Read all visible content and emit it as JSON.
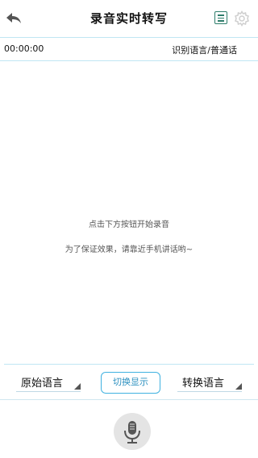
{
  "header": {
    "title": "录音实时转写",
    "back_icon": "back-arrow-icon",
    "list_icon": "list-icon",
    "settings_icon": "gear-icon"
  },
  "status": {
    "time": "00:00:00",
    "language_label": "识别语言/普通话"
  },
  "content": {
    "hint_line1": "点击下方按钮开始录音",
    "hint_line2": "为了保证效果，请靠近手机讲话哟~"
  },
  "controls": {
    "source_language": "原始语言",
    "switch_display": "切换显示",
    "target_language": "转换语言"
  },
  "record": {
    "icon": "microphone-icon"
  },
  "colors": {
    "accent": "#3fb1e0",
    "divider": "#bfe6f3",
    "list_icon": "#2e7d6b"
  }
}
